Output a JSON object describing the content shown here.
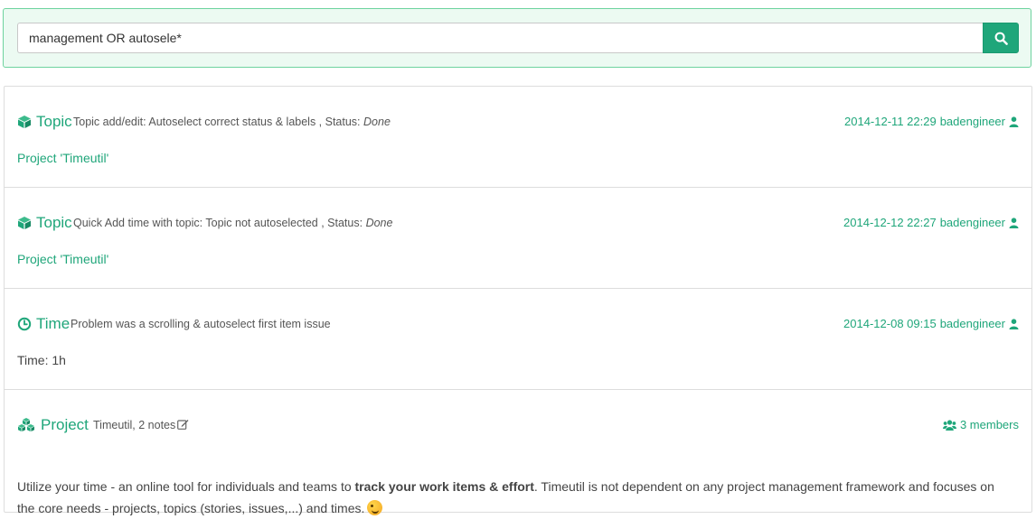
{
  "search": {
    "value": "management OR autosele*",
    "button_icon": "search-icon"
  },
  "colors": {
    "accent": "#1fa67a",
    "search_panel_bg": "#ecfaf2",
    "search_panel_border": "#6ed39f"
  },
  "results": [
    {
      "type": "Topic",
      "icon": "cube-icon",
      "description": "Topic add/edit: Autoselect correct status & labels , Status: ",
      "status": "Done",
      "datetime": "2014-12-11 22:29",
      "user": "badengineer",
      "sub": "Project 'Timeutil'"
    },
    {
      "type": "Topic",
      "icon": "cube-icon",
      "description": "Quick Add time with topic: Topic not autoselected , Status: ",
      "status": "Done",
      "datetime": "2014-12-12 22:27",
      "user": "badengineer",
      "sub": "Project 'Timeutil'"
    },
    {
      "type": "Time",
      "icon": "clock-icon",
      "description": "Problem was a scrolling & autoselect first item issue",
      "datetime": "2014-12-08 09:15",
      "user": "badengineer",
      "sub": "Time: 1h"
    },
    {
      "type": "Project",
      "icon": "cubes-icon",
      "description": "Timeutil, 2 notes",
      "members": "3 members",
      "text_before": "Utilize your time - an online tool for individuals and teams to ",
      "text_bold": "track your work items & effort",
      "text_after": ". Timeutil is not dependent on any project management framework and focuses on the core needs - projects, topics (stories, issues,...) and times."
    }
  ]
}
